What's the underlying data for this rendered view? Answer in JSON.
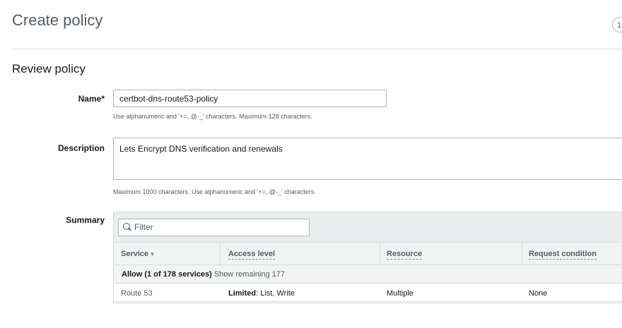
{
  "header": {
    "title": "Create policy",
    "step_number": "1"
  },
  "section": {
    "title": "Review policy"
  },
  "form": {
    "name_label": "Name*",
    "name_value": "certbot-dns-route53-policy",
    "name_hint": "Use alphanumeric and '+=,.@-_' characters. Maximum 128 characters.",
    "description_label": "Description",
    "description_value": "Lets Encrypt DNS verification and renewals",
    "description_hint": "Maximum 1000 characters. Use alphanumeric and '+=,.@-_' characters.",
    "summary_label": "Summary"
  },
  "summary": {
    "filter_placeholder": "Filter",
    "columns": {
      "service": "Service",
      "access_level": "Access level",
      "resource": "Resource",
      "request_condition": "Request condition"
    },
    "group": {
      "title": "Allow (1 of 178 services)",
      "link": "Show remaining 177"
    },
    "rows": [
      {
        "service": "Route 53",
        "access_level_strong": "Limited",
        "access_level_rest": ": List, Write",
        "resource": "Multiple",
        "request_condition": "None"
      }
    ]
  }
}
